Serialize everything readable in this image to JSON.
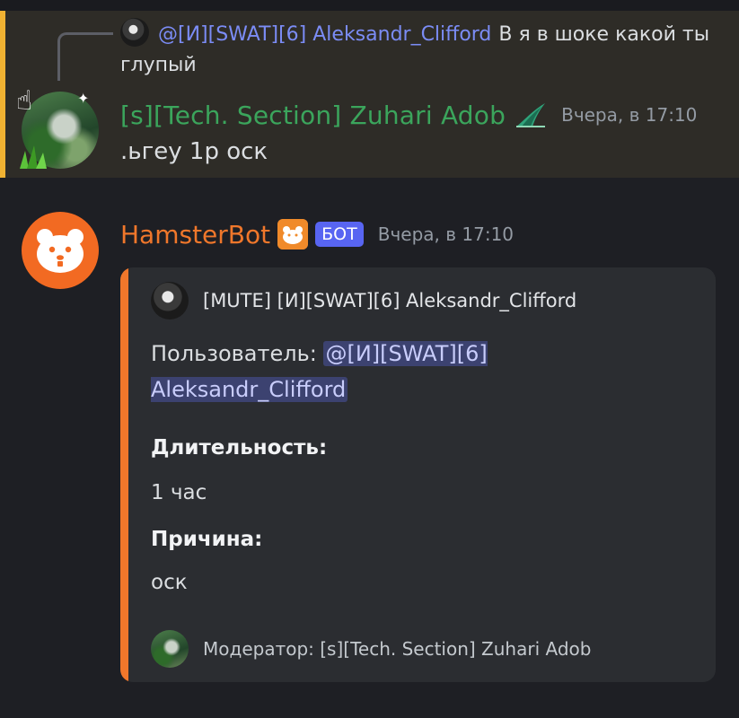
{
  "reply": {
    "author": "@[И][SWAT][6] Aleksandr_Clifford",
    "text": "В я в шоке какой ты глупый"
  },
  "message": {
    "author": "[s][Tech. Section] Zuhari Adob",
    "timestamp": "Вчера, в 17:10",
    "text": ".ьгеу 1р оск",
    "author_color": "#3ba55c",
    "highlight_color": "#f0b232"
  },
  "bot_message": {
    "author": "HamsterBot",
    "tag": "БОТ",
    "timestamp": "Вчера, в 17:10",
    "author_color": "#f0772b"
  },
  "embed": {
    "accent_color": "#f0772b",
    "author": "[MUTE] [И][SWAT][6] Aleksandr_Clifford",
    "description_label": "Пользователь:",
    "description_mention": "@[И][SWAT][6] Aleksandr_Clifford",
    "fields": [
      {
        "name": "Длительность:",
        "value": "1 час"
      },
      {
        "name": "Причина:",
        "value": "оск"
      }
    ],
    "footer": "Модератор: [s][Tech. Section] Zuhari Adob"
  },
  "icons": {
    "author_role_icon": "leaf-sail-role-icon",
    "bot_emoji": "hamster-emoji-icon",
    "bot_avatar": "hamster-face-icon"
  }
}
